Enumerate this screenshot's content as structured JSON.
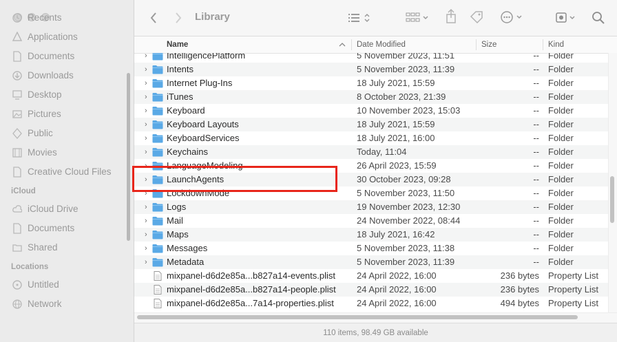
{
  "window": {
    "title": "Library"
  },
  "sidebar": {
    "items_top": [
      {
        "label": "Recents",
        "icon": "clock-icon"
      },
      {
        "label": "Applications",
        "icon": "applications-icon"
      },
      {
        "label": "Documents",
        "icon": "document-icon"
      },
      {
        "label": "Downloads",
        "icon": "download-icon"
      },
      {
        "label": "Desktop",
        "icon": "desktop-icon"
      },
      {
        "label": "Pictures",
        "icon": "pictures-icon"
      },
      {
        "label": "Public",
        "icon": "public-icon"
      },
      {
        "label": "Movies",
        "icon": "movies-icon"
      },
      {
        "label": "Creative Cloud Files",
        "icon": "document-icon"
      }
    ],
    "icloud_header": "iCloud",
    "icloud_items": [
      {
        "label": "iCloud Drive",
        "icon": "cloud-icon"
      },
      {
        "label": "Documents",
        "icon": "document-icon"
      },
      {
        "label": "Shared",
        "icon": "shared-folder-icon"
      }
    ],
    "locations_header": "Locations",
    "location_items": [
      {
        "label": "Untitled",
        "icon": "disk-icon"
      },
      {
        "label": "Network",
        "icon": "globe-icon"
      }
    ]
  },
  "columns": {
    "name": "Name",
    "date": "Date Modified",
    "size": "Size",
    "kind": "Kind"
  },
  "rows": [
    {
      "name": "IntelligencePlatform",
      "date": "5 November 2023, 11:51",
      "size": "--",
      "kind": "Folder",
      "type": "folder"
    },
    {
      "name": "Intents",
      "date": "5 November 2023, 11:39",
      "size": "--",
      "kind": "Folder",
      "type": "folder"
    },
    {
      "name": "Internet Plug-Ins",
      "date": "18 July 2021, 15:59",
      "size": "--",
      "kind": "Folder",
      "type": "folder"
    },
    {
      "name": "iTunes",
      "date": "8 October 2023, 21:39",
      "size": "--",
      "kind": "Folder",
      "type": "folder"
    },
    {
      "name": "Keyboard",
      "date": "10 November 2023, 15:03",
      "size": "--",
      "kind": "Folder",
      "type": "folder"
    },
    {
      "name": "Keyboard Layouts",
      "date": "18 July 2021, 15:59",
      "size": "--",
      "kind": "Folder",
      "type": "folder"
    },
    {
      "name": "KeyboardServices",
      "date": "18 July 2021, 16:00",
      "size": "--",
      "kind": "Folder",
      "type": "folder"
    },
    {
      "name": "Keychains",
      "date": "Today, 11:04",
      "size": "--",
      "kind": "Folder",
      "type": "folder"
    },
    {
      "name": "LanguageModeling",
      "date": "26 April 2023, 15:59",
      "size": "--",
      "kind": "Folder",
      "type": "folder"
    },
    {
      "name": "LaunchAgents",
      "date": "30 October 2023, 09:28",
      "size": "--",
      "kind": "Folder",
      "type": "folder"
    },
    {
      "name": "LockdownMode",
      "date": "5 November 2023, 11:50",
      "size": "--",
      "kind": "Folder",
      "type": "folder"
    },
    {
      "name": "Logs",
      "date": "19 November 2023, 12:30",
      "size": "--",
      "kind": "Folder",
      "type": "folder"
    },
    {
      "name": "Mail",
      "date": "24 November 2022, 08:44",
      "size": "--",
      "kind": "Folder",
      "type": "folder"
    },
    {
      "name": "Maps",
      "date": "18 July 2021, 16:42",
      "size": "--",
      "kind": "Folder",
      "type": "folder"
    },
    {
      "name": "Messages",
      "date": "5 November 2023, 11:38",
      "size": "--",
      "kind": "Folder",
      "type": "folder"
    },
    {
      "name": "Metadata",
      "date": "5 November 2023, 11:39",
      "size": "--",
      "kind": "Folder",
      "type": "folder"
    },
    {
      "name": "mixpanel-d6d2e85a...b827a14-events.plist",
      "date": "24 April 2022, 16:00",
      "size": "236 bytes",
      "kind": "Property List",
      "type": "file"
    },
    {
      "name": "mixpanel-d6d2e85a...b827a14-people.plist",
      "date": "24 April 2022, 16:00",
      "size": "236 bytes",
      "kind": "Property List",
      "type": "file"
    },
    {
      "name": "mixpanel-d6d2e85a...7a14-properties.plist",
      "date": "24 April 2022, 16:00",
      "size": "494 bytes",
      "kind": "Property List",
      "type": "file"
    }
  ],
  "highlighted_row": "LaunchAgents",
  "status": "110 items, 98.49 GB available",
  "colors": {
    "folder": "#5aa9e6",
    "highlight": "#e8261b"
  }
}
